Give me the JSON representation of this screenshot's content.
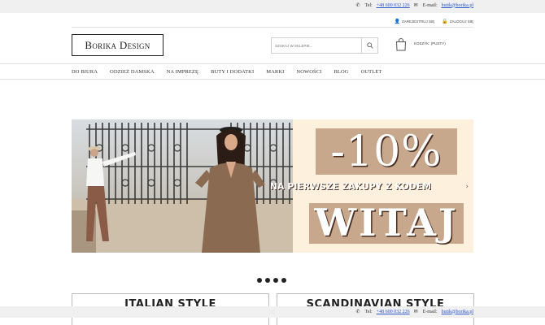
{
  "contact": {
    "phone_label": "Tel:",
    "phone": "+48 600 032 226",
    "email_label": "E-mail:",
    "email": "butik@borika.pl"
  },
  "account": {
    "register": "Zarejestruj się",
    "login": "Zaloguj się"
  },
  "header": {
    "logo": "Borika Design",
    "search_placeholder": "Szukaj w sklepie...",
    "cart_label": "Koszyk: (pusty)"
  },
  "nav": {
    "items": [
      "Do biura",
      "Odzież damska",
      "Na imprezę",
      "Buty i dodatki",
      "Marki",
      "Nowości",
      "Blog",
      "Outlet"
    ]
  },
  "banner": {
    "discount": "-10%",
    "subtitle": "na pierwsze zakupy z kodem",
    "code": "WITAJ"
  },
  "slider": {
    "dots": 4
  },
  "cards": [
    "Italian Style",
    "Scandinavian Style"
  ],
  "icons": {
    "phone": "phone-icon",
    "email": "envelope-icon",
    "register": "user-icon",
    "login": "lock-icon",
    "search": "search-icon",
    "cart": "shopping-bag-icon",
    "next": "chevron-right-icon"
  },
  "colors": {
    "link": "#2a55c8",
    "promo_bg": "#fdf1dd",
    "promo_box": "#c7a88c",
    "text_shadow": "#4a2e22"
  }
}
